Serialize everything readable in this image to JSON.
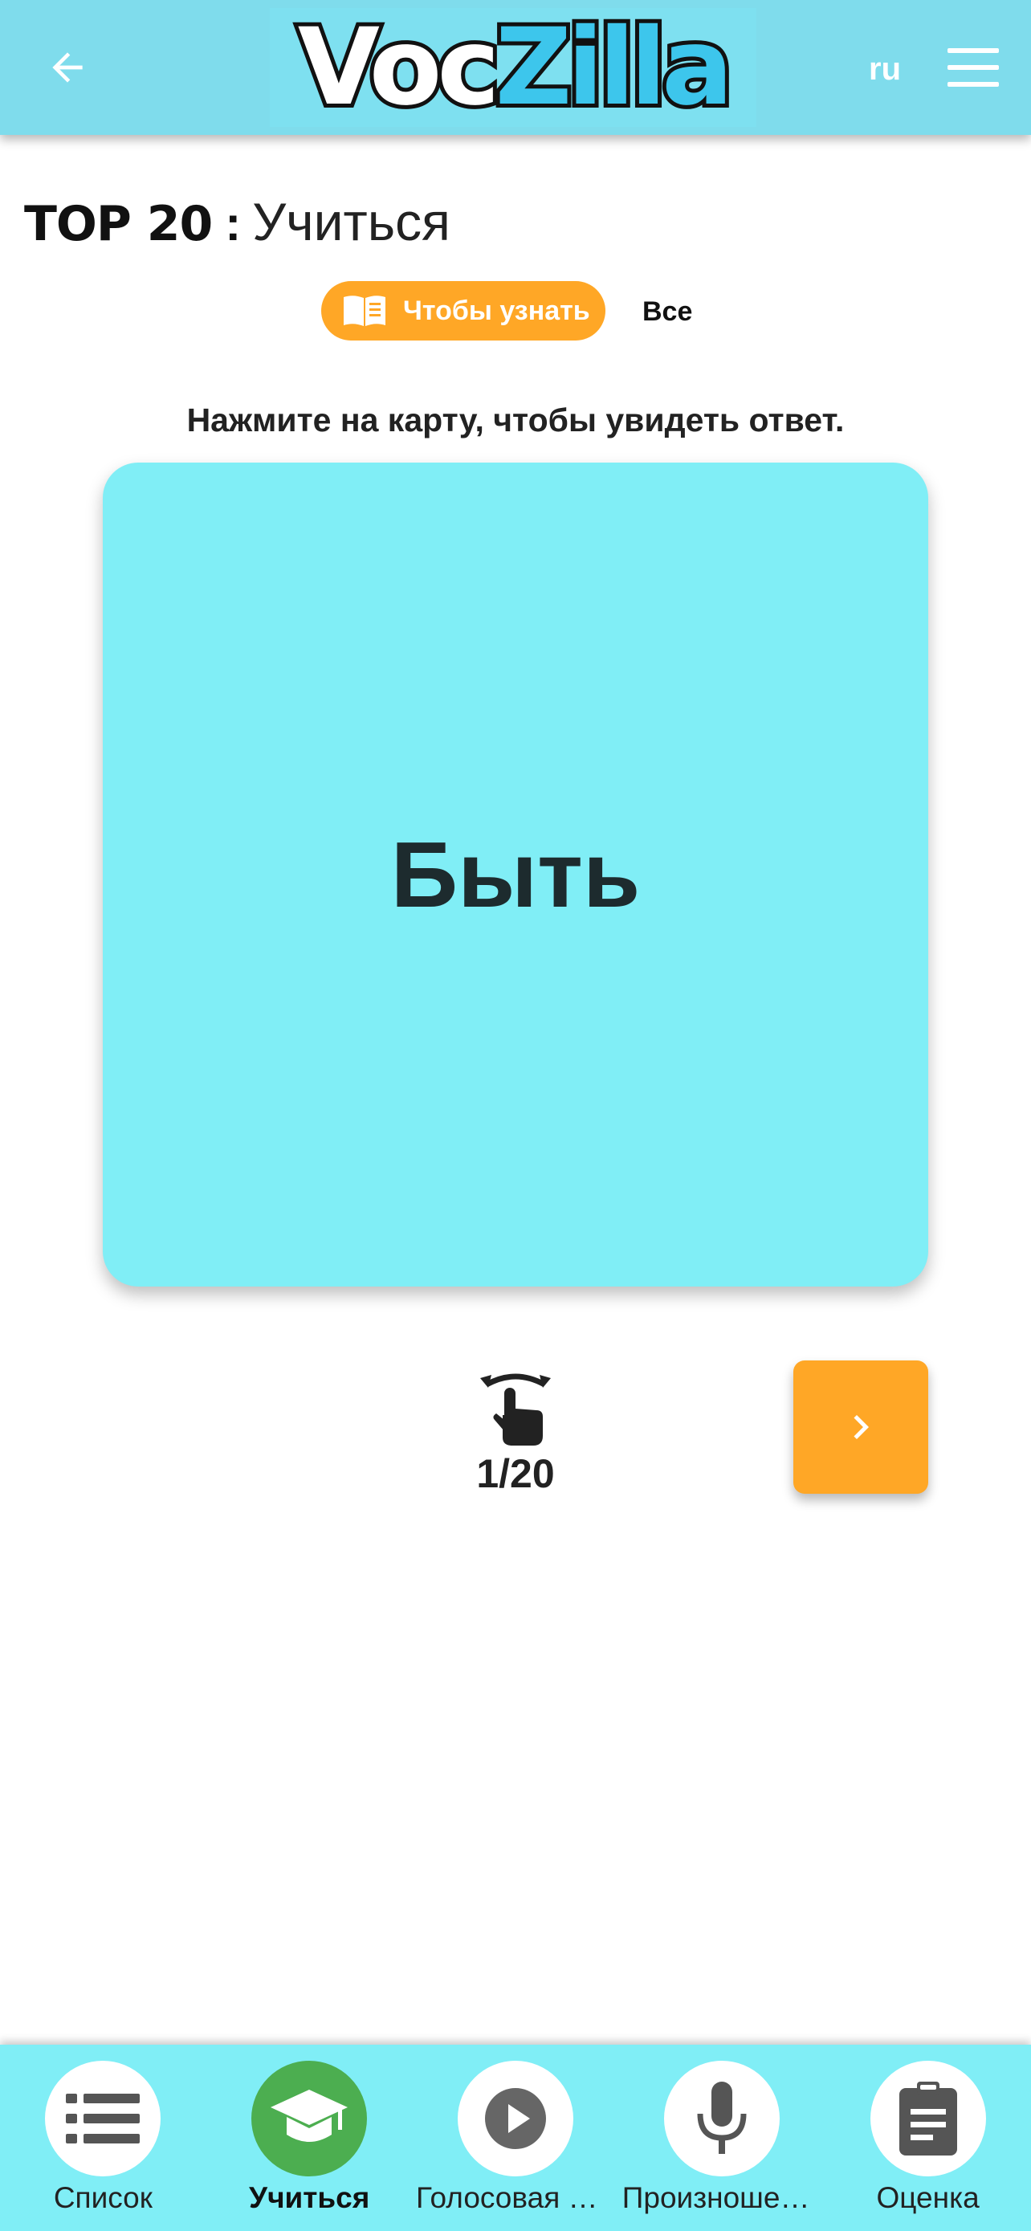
{
  "header": {
    "logo": {
      "part1": "Voc",
      "part2": "Zilla"
    },
    "lang_label": "ru",
    "colors": {
      "background": "#7fdcec",
      "logo_accent": "#3dc6ec"
    }
  },
  "title": {
    "brand": "TOP 20",
    "separator": ":",
    "mode": "Учиться"
  },
  "mode_tabs": {
    "learn_label": "Чтобы узнать",
    "all_label": "Все",
    "learn_color": "#ffa726"
  },
  "instruction": "Нажмите на карту, чтобы увидеть ответ.",
  "card": {
    "word": "Быть",
    "color": "#80eef6"
  },
  "progress": {
    "text": "1/20",
    "current": 1,
    "total": 20
  },
  "icons": {
    "back": "arrow-left-icon",
    "menu": "hamburger-menu-icon",
    "learn_tab": "book-icon",
    "flip": "tap-rotate-icon",
    "next": "chevron-right-icon"
  },
  "bottom_nav": {
    "items": [
      {
        "label": "Список",
        "icon": "list-icon",
        "active": false
      },
      {
        "label": "Учиться",
        "icon": "graduation-cap-icon",
        "active": true
      },
      {
        "label": "Голосовая дорожка",
        "icon": "play-icon",
        "active": false
      },
      {
        "label": "Произношение",
        "icon": "microphone-icon",
        "active": false
      },
      {
        "label": "Оценка",
        "icon": "clipboard-icon",
        "active": false
      }
    ],
    "active_color": "#4cae50"
  }
}
